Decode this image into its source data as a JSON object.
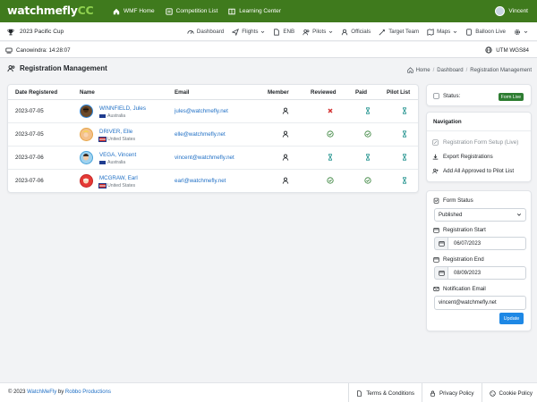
{
  "brand": {
    "name_main": "watchmefly",
    "name_accent": "CC"
  },
  "topnav": {
    "items": [
      {
        "label": "WMF Home",
        "icon": "home-icon"
      },
      {
        "label": "Competition List",
        "icon": "list-icon"
      },
      {
        "label": "Learning Center",
        "icon": "book-icon"
      }
    ],
    "user": "Vincent"
  },
  "competition": {
    "name": "2023 Pacific Cup",
    "icon": "trophy-icon"
  },
  "subnav": {
    "items": [
      {
        "label": "Dashboard",
        "icon": "dashboard-icon"
      },
      {
        "label": "Flights",
        "icon": "plane-icon"
      },
      {
        "label": "ENB",
        "icon": "document-icon"
      },
      {
        "label": "Pilots",
        "icon": "users-icon"
      },
      {
        "label": "Officials",
        "icon": "officials-icon"
      },
      {
        "label": "Target Team",
        "icon": "target-icon"
      },
      {
        "label": "Maps",
        "icon": "map-icon"
      },
      {
        "label": "Balloon Live",
        "icon": "tablet-icon"
      },
      {
        "label": "",
        "icon": "gear-icon"
      }
    ]
  },
  "info": {
    "location_time": "Canowindra: 14:28:07",
    "coords": "UTM WGS84"
  },
  "page": {
    "title": "Registration Management"
  },
  "breadcrumb": {
    "home": "Home",
    "dashboard": "Dashboard",
    "current": "Registration Management"
  },
  "table": {
    "headers": {
      "date": "Date Registered",
      "name": "Name",
      "email": "Email",
      "member": "Member",
      "reviewed": "Reviewed",
      "paid": "Paid",
      "pilot_list": "Pilot List"
    },
    "rows": [
      {
        "date": "2023-07-05",
        "name": "WINNFIELD, Jules",
        "country": "Australia",
        "email": "jules@watchmefly.net",
        "member": "user-icon",
        "reviewed": "x-icon",
        "paid": "hourglass-icon",
        "pilot_list": "hourglass-icon"
      },
      {
        "date": "2023-07-05",
        "name": "DRIVER, Elle",
        "country": "United States",
        "email": "elle@watchmefly.net",
        "member": "user-icon",
        "reviewed": "check-circle-icon",
        "paid": "check-circle-icon",
        "pilot_list": "hourglass-icon"
      },
      {
        "date": "2023-07-06",
        "name": "VEGA, Vincent",
        "country": "Australia",
        "email": "vincent@watchmefly.net",
        "member": "user-icon",
        "reviewed": "hourglass-icon",
        "paid": "hourglass-icon",
        "pilot_list": "hourglass-icon"
      },
      {
        "date": "2023-07-06",
        "name": "MCGRAW, Earl",
        "country": "United States",
        "email": "earl@watchmefly.net",
        "member": "user-icon",
        "reviewed": "check-circle-icon",
        "paid": "check-circle-icon",
        "pilot_list": "hourglass-icon"
      }
    ]
  },
  "status_card": {
    "label": "Status:",
    "badge": "Form Live"
  },
  "navigation": {
    "title": "Navigation",
    "items": [
      {
        "label": "Registration Form Setup (Live)",
        "icon": "edit-icon"
      },
      {
        "label": "Export Registrations",
        "icon": "download-icon"
      },
      {
        "label": "Add All Approved to Pilot List",
        "icon": "user-plus-icon"
      }
    ]
  },
  "form": {
    "status_label": "Form Status",
    "status_value": "Published",
    "start_label": "Registration Start",
    "start_value": "06/07/2023",
    "end_label": "Registration End",
    "end_value": "08/09/2023",
    "email_label": "Notification Email",
    "email_value": "vincent@watchmefly.net",
    "update_label": "Update"
  },
  "footer": {
    "copyright_prefix": "© 2023",
    "brand_link": "WatchMeFly",
    "by": "by",
    "company_link": "Robbo Productions",
    "links": [
      {
        "label": "Terms & Conditions",
        "icon": "document-icon"
      },
      {
        "label": "Privacy Policy",
        "icon": "lock-icon"
      },
      {
        "label": "Cookie Policy",
        "icon": "cookie-icon"
      }
    ]
  },
  "colors": {
    "topbar": "#3f7a1d",
    "accent": "#1f6fc5",
    "success": "#2e7d32",
    "danger": "#d32f2f",
    "primary": "#1e88e5"
  }
}
